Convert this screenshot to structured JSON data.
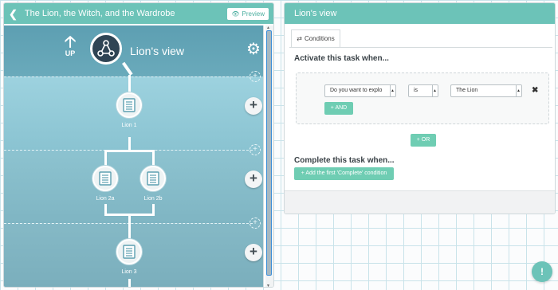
{
  "left_panel": {
    "title": "The Lion, the Witch, and the Wardrobe",
    "back_icon": "chevron-left-icon",
    "preview_label": "Preview",
    "up_label": "UP",
    "root_title": "Lion's view",
    "nodes": [
      "Lion 1",
      "Lion 2a",
      "Lion 2b",
      "Lion 3"
    ],
    "add_symbol": "+"
  },
  "right_panel": {
    "title": "Lion's view",
    "tab_label": "Conditions",
    "activate_heading": "Activate this task when...",
    "condition": {
      "field": "Do you want to explo",
      "operator": "is",
      "value": "The Lion"
    },
    "and_label": "AND",
    "or_label": "OR",
    "complete_heading": "Complete this task when...",
    "add_complete_label": "Add the first 'Complete' condition"
  },
  "colors": {
    "accent": "#6cc3b8",
    "button_green": "#6fcdb3",
    "root_node": "#2f4454"
  }
}
